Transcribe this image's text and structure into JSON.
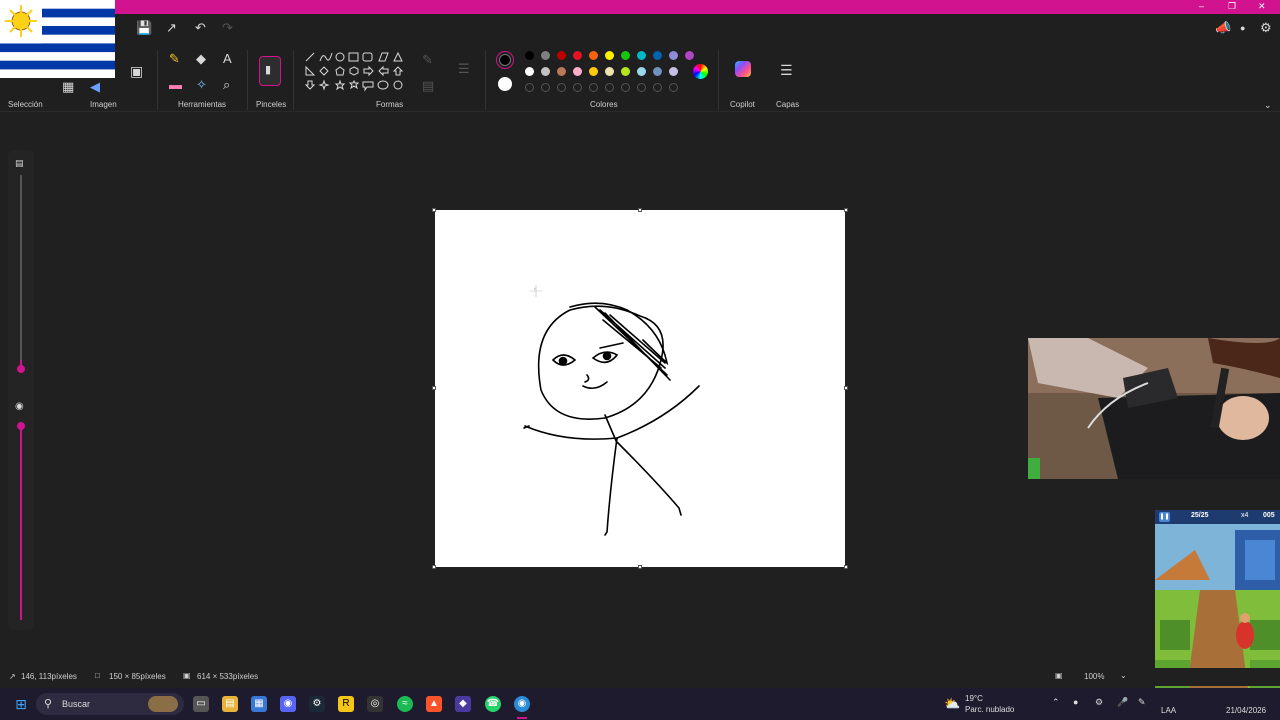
{
  "window": {
    "minimize": "–",
    "restore": "❐",
    "close": "✕"
  },
  "ribbon": {
    "groups": {
      "seleccion": "Selección",
      "imagen": "Imagen",
      "herramientas": "Herramientas",
      "pinceles": "Pinceles",
      "formas": "Formas",
      "colores": "Colores",
      "copilot": "Copilot",
      "capas": "Capas"
    },
    "tools": {
      "pencil": "✎",
      "fill": "◆",
      "text": "A",
      "eraser": "▬",
      "picker": "✧",
      "zoom": "⌕"
    },
    "colors": {
      "primary": "#000000",
      "secondary": "#ffffff",
      "row1": [
        "#000000",
        "#7f7f7f",
        "#c00000",
        "#e81123",
        "#f7630c",
        "#fff100",
        "#16c60c",
        "#00b7c3",
        "#0063b1",
        "#8e8cd8",
        "#b146c2"
      ],
      "row2": [
        "#ffffff",
        "#c3c3c3",
        "#b97a57",
        "#ffaec9",
        "#ffc90e",
        "#efe4b0",
        "#b5e61d",
        "#99d9ea",
        "#7092be",
        "#c8bfe7"
      ]
    }
  },
  "status": {
    "cursor_pos": "146, 113píxeles",
    "selection_size": "150 × 85píxeles",
    "canvas_size": "614 × 533píxeles",
    "zoom": "100%"
  },
  "taskbar": {
    "search_placeholder": "Buscar",
    "weather_temp": "19°C",
    "weather_desc": "Parc. nublado",
    "lang": "LAA",
    "date": "21/04/2026"
  },
  "game_overlay": {
    "counter": "25/25",
    "multiplier": "x4",
    "score": "005"
  },
  "accent_color": "#d1138f"
}
